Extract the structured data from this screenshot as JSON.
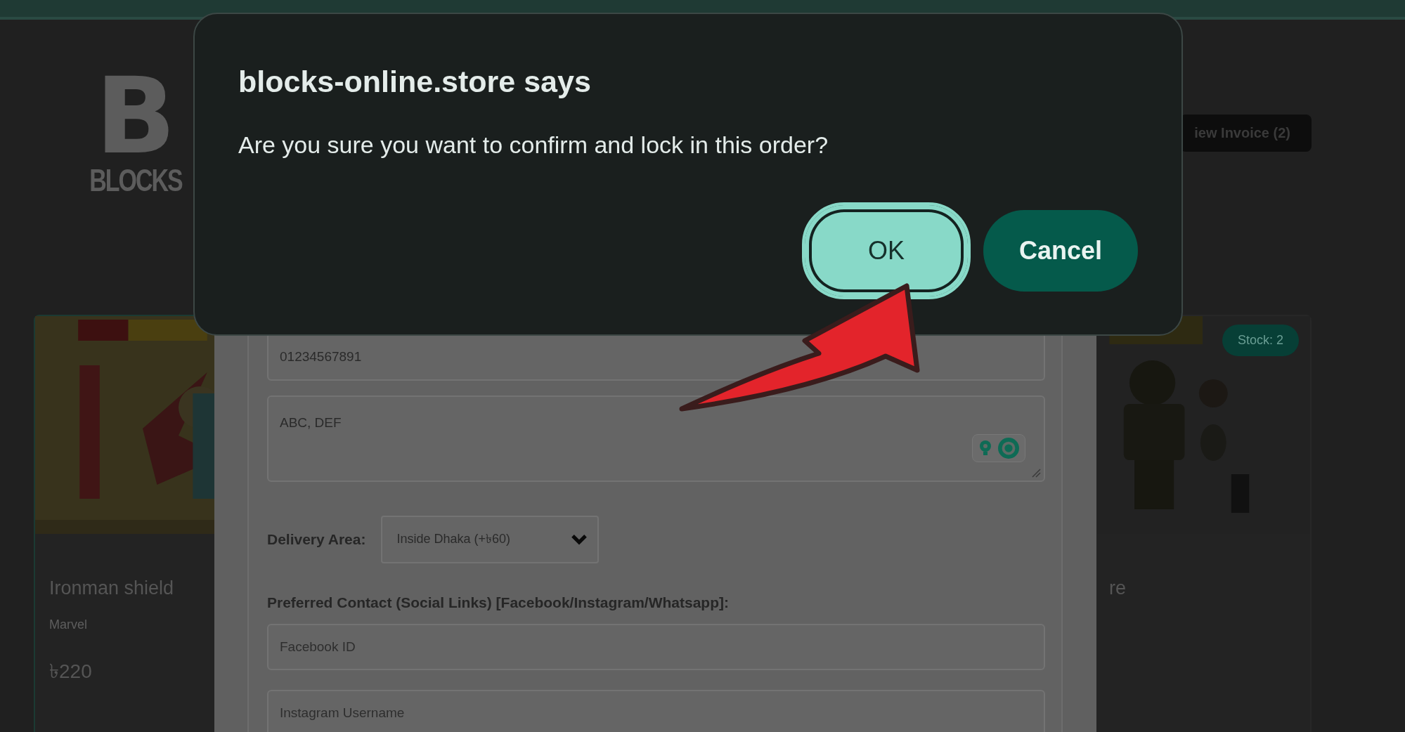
{
  "logo": {
    "mark": "B",
    "wordmark": "BLOCKS"
  },
  "header": {
    "invoice_button": "iew Invoice (2)"
  },
  "products": [
    {
      "name": "Ironman shield",
      "brand": "Marvel",
      "price": "৳220"
    },
    {
      "name": "re",
      "stock_badge": "Stock: 2"
    }
  ],
  "order_form": {
    "fields": [
      {
        "kind": "input",
        "value": "01234567891"
      },
      {
        "kind": "textarea",
        "value": "ABC, DEF"
      }
    ],
    "delivery_area": {
      "label": "Delivery Area:",
      "value": "Inside Dhaka (+৳60)"
    },
    "contact": {
      "label": "Preferred Contact (Social Links) [Facebook/Instagram/Whatsapp]:",
      "fields": [
        {
          "placeholder": "Facebook ID"
        },
        {
          "placeholder": "Instagram Username"
        }
      ]
    }
  },
  "dialog": {
    "title": "blocks-online.store says",
    "message": "Are you sure you want to confirm and lock in this order?",
    "buttons": [
      {
        "label": "OK",
        "focused": true
      },
      {
        "label": "Cancel",
        "focused": false
      }
    ]
  }
}
